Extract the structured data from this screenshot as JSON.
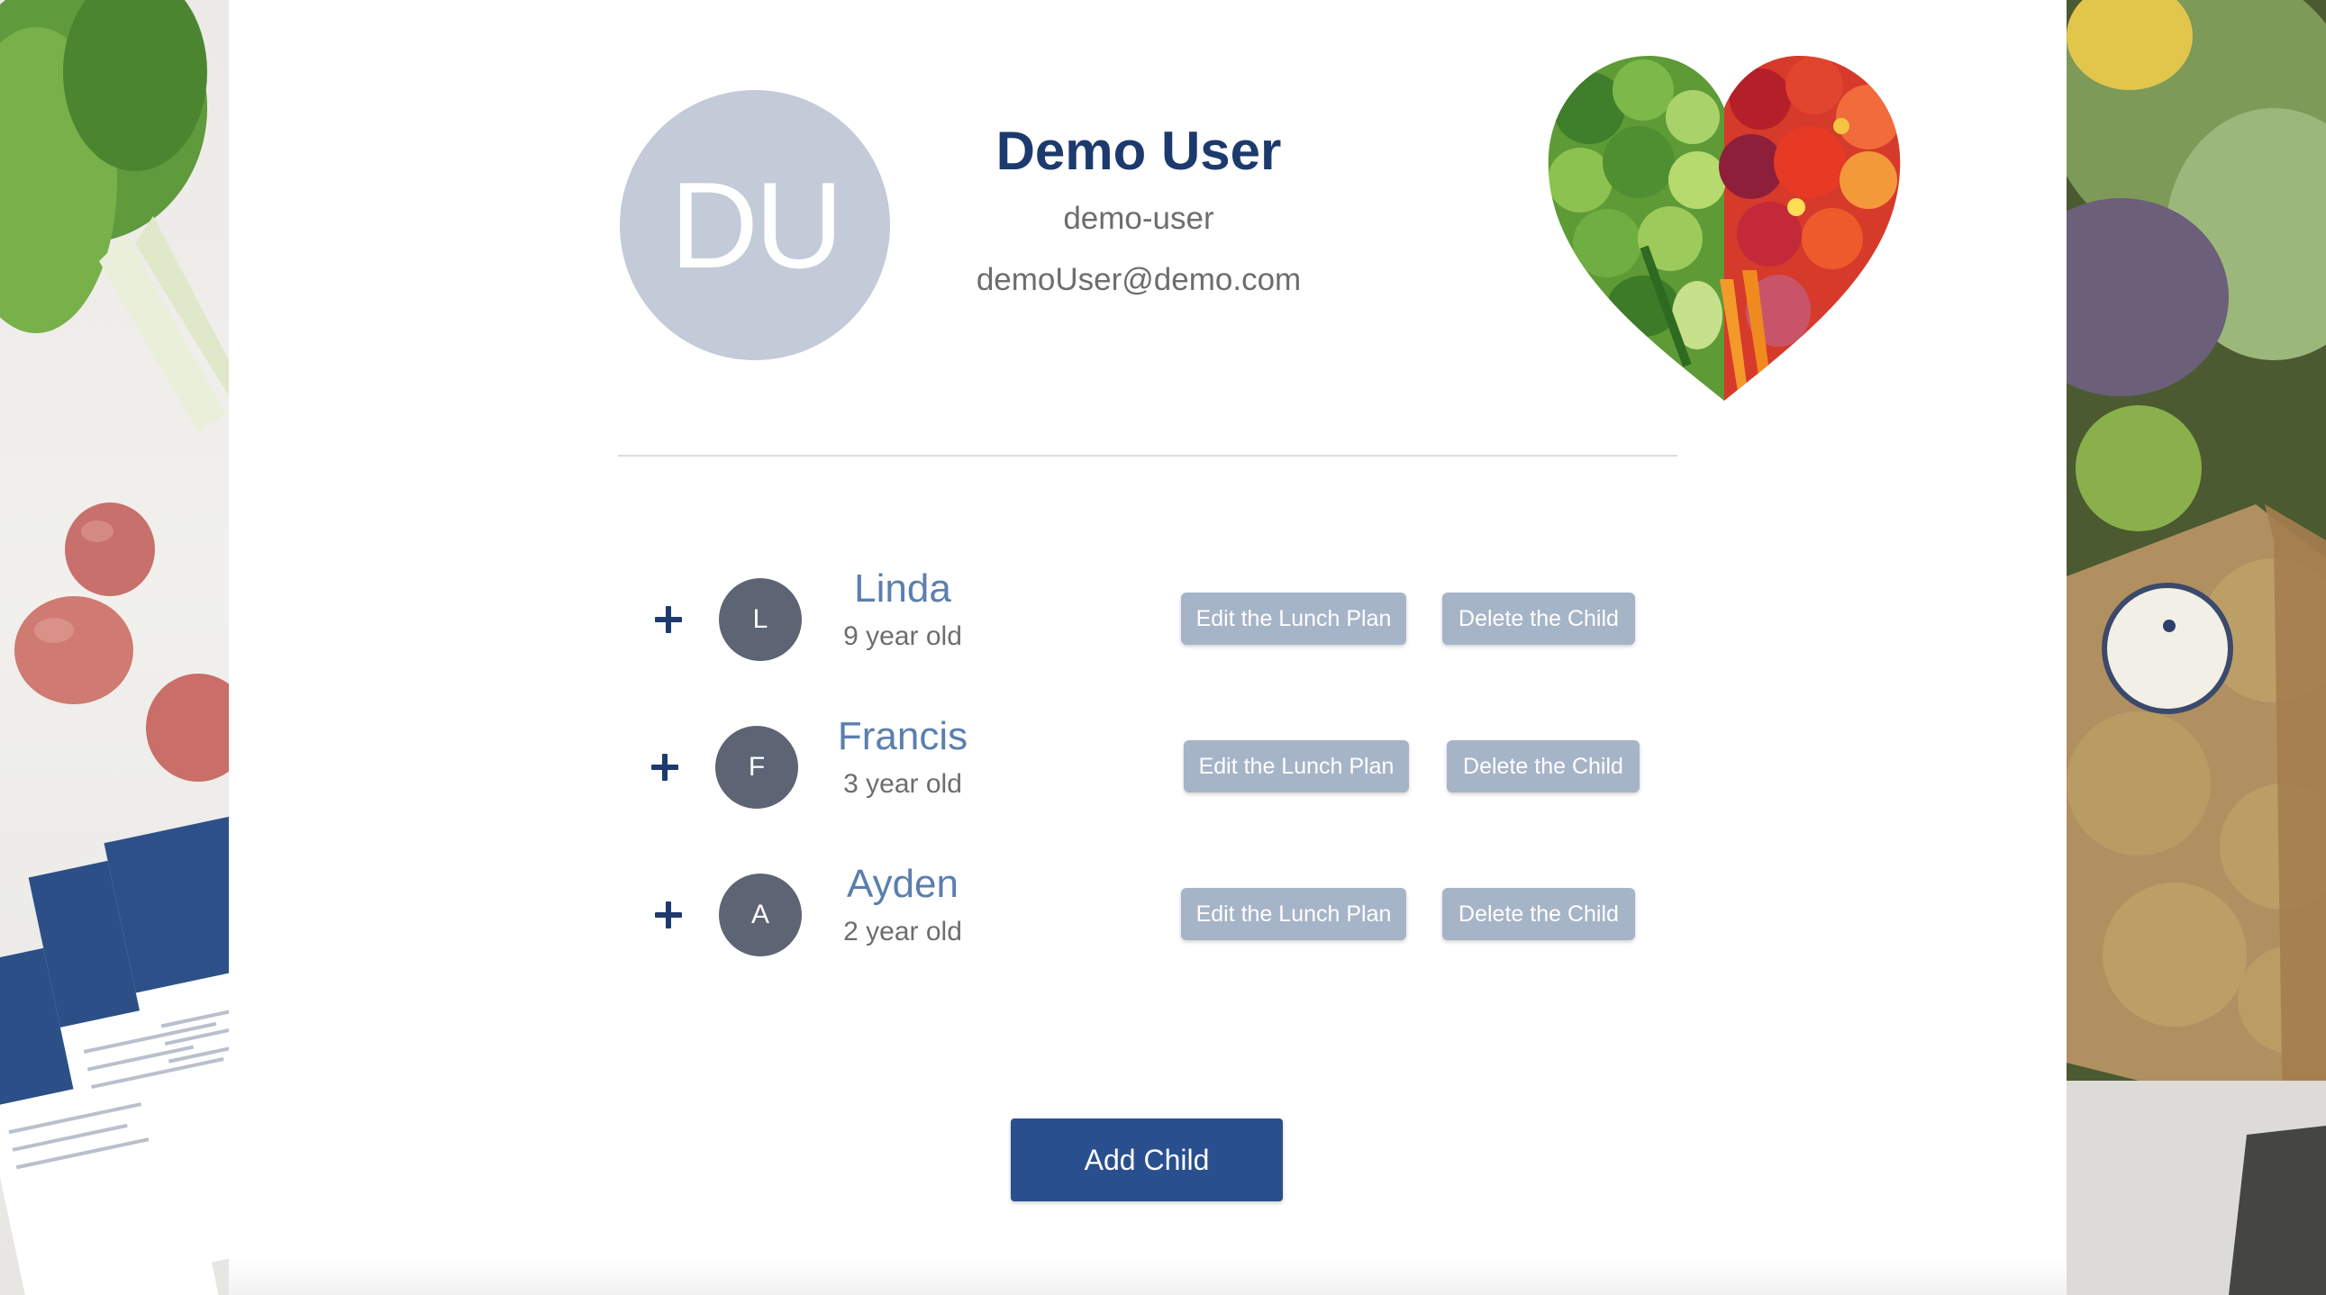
{
  "profile": {
    "initials": "DU",
    "name": "Demo User",
    "username": "demo-user",
    "email": "demoUser@demo.com"
  },
  "children": [
    {
      "initial": "L",
      "name": "Linda",
      "age": "9 year old"
    },
    {
      "initial": "F",
      "name": "Francis",
      "age": "3 year old"
    },
    {
      "initial": "A",
      "name": "Ayden",
      "age": "2 year old"
    }
  ],
  "actions": {
    "edit_label": "Edit the Lunch Plan",
    "delete_label": "Delete the Child",
    "add_child_label": "Add Child"
  },
  "colors": {
    "brand_navy": "#1d3a6e",
    "avatar_bg": "#c3cad8",
    "child_avatar_bg": "#5d6474",
    "child_name": "#5b7fae",
    "secondary_button": "#a6b4c8",
    "primary_button": "#294f8e"
  }
}
